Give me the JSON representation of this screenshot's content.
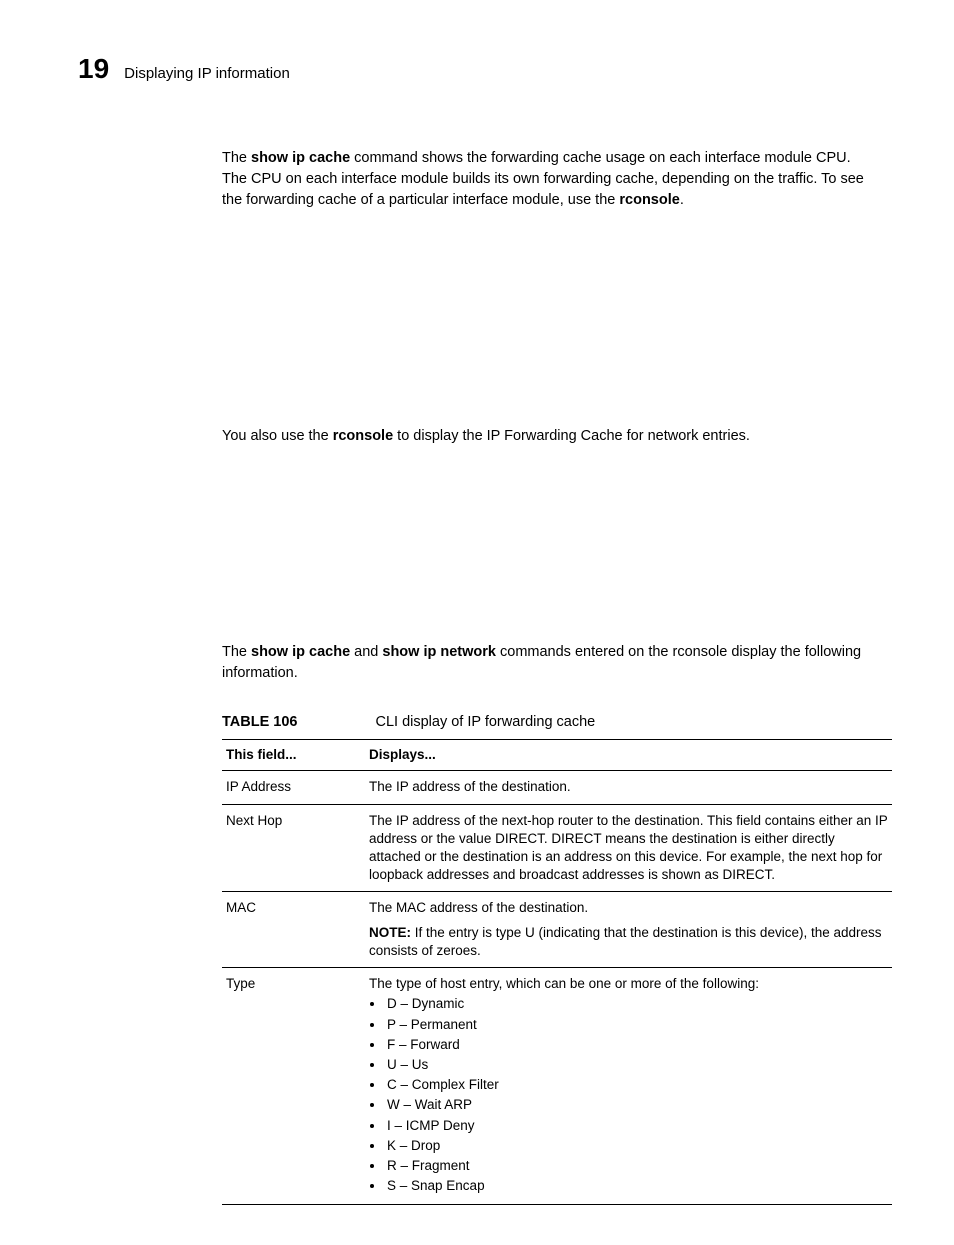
{
  "header": {
    "chapter_number": "19",
    "section_title": "Displaying IP information"
  },
  "paragraph1": {
    "pre": "The ",
    "cmd1": "show ip cache",
    "mid": " command shows the forwarding cache usage on each interface module CPU. The CPU on each interface module builds its own forwarding cache, depending on the traffic. To see the forwarding cache of a particular interface module, use the ",
    "cmd2": "rconsole",
    "post": "."
  },
  "paragraph2": {
    "pre": "You also use the ",
    "cmd1": "rconsole",
    "post": " to display the IP Forwarding Cache for network entries."
  },
  "paragraph3": {
    "pre": "The ",
    "cmd1": "show ip cache",
    "mid1": " and ",
    "cmd2": "show ip network",
    "post": " commands entered on the rconsole display the following information."
  },
  "table": {
    "label": "TABLE 106",
    "caption": "CLI display of IP forwarding cache",
    "head_field": "This field...",
    "head_displays": "Displays...",
    "rows": [
      {
        "field": "IP Address",
        "displays": "The IP address of the destination."
      },
      {
        "field": "Next Hop",
        "displays": "The IP address of the next-hop router to the destination. This field contains either an IP address or the value DIRECT. DIRECT means the destination is either directly attached or the destination is an address on this device. For example, the next hop for loopback addresses and broadcast addresses is shown as DIRECT."
      },
      {
        "field": "MAC",
        "displays": "The MAC address of the destination.",
        "note_label": "NOTE: ",
        "note": "If the entry is type U (indicating that the destination is this device), the address consists of zeroes."
      },
      {
        "field": "Type",
        "intro": "The type of host entry, which can be one or more of the following:",
        "items": [
          "D – Dynamic",
          "P – Permanent",
          "F – Forward",
          "U – Us",
          "C – Complex Filter",
          "W – Wait ARP",
          "I – ICMP Deny",
          "K – Drop",
          "R – Fragment",
          "S – Snap Encap"
        ]
      }
    ]
  }
}
